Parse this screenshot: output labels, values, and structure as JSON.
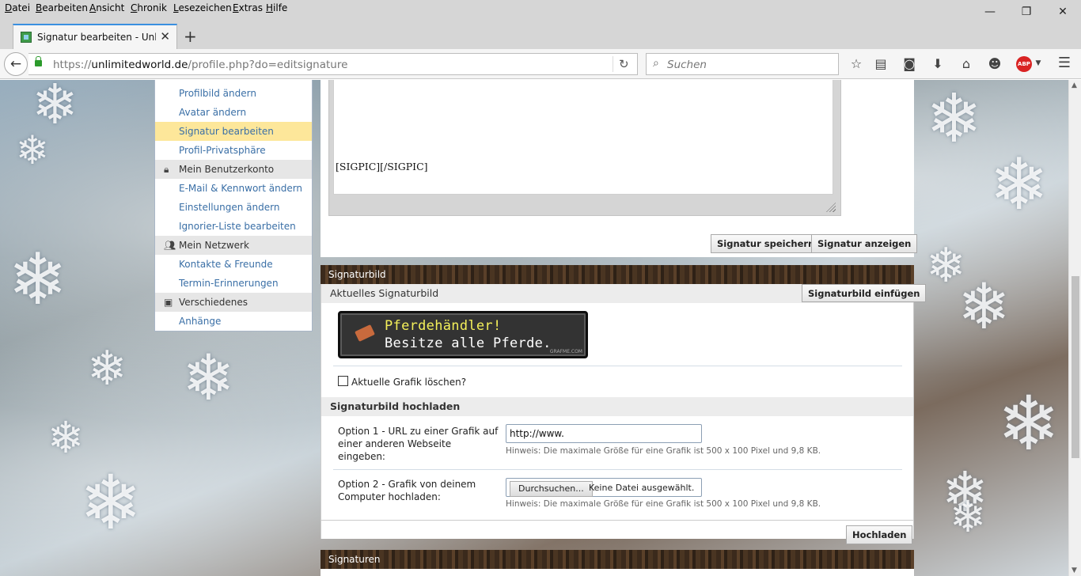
{
  "menubar": {
    "items": [
      {
        "pre": "",
        "key": "D",
        "post": "atei"
      },
      {
        "pre": "",
        "key": "B",
        "post": "earbeiten"
      },
      {
        "pre": "",
        "key": "A",
        "post": "nsicht"
      },
      {
        "pre": "",
        "key": "C",
        "post": "hronik"
      },
      {
        "pre": "",
        "key": "L",
        "post": "esezeichen"
      },
      {
        "pre": "",
        "key": "E",
        "post": "xtras"
      },
      {
        "pre": "",
        "key": "H",
        "post": "ilfe"
      }
    ]
  },
  "window_controls": {
    "minimize": "—",
    "restore": "❐",
    "close": "✕"
  },
  "tab": {
    "title": "Signatur bearbeiten - Unli...",
    "close": "✕",
    "new_tab": "+"
  },
  "navbar": {
    "url_prefix": "https://",
    "url_domain": "unlimitedworld.de",
    "url_path": "/profile.php?do=editsignature",
    "search_placeholder": "Suchen",
    "abp_label": "ABP"
  },
  "sidemenu": {
    "items": [
      {
        "type": "link",
        "label": "Profilbild ändern"
      },
      {
        "type": "link",
        "label": "Avatar ändern"
      },
      {
        "type": "link",
        "label": "Signatur bearbeiten",
        "active": true
      },
      {
        "type": "link",
        "label": "Profil-Privatsphäre"
      },
      {
        "type": "cat",
        "label": "Mein Benutzerkonto",
        "icon": "lock-icon"
      },
      {
        "type": "link",
        "label": "E-Mail & Kennwort ändern"
      },
      {
        "type": "link",
        "label": "Einstellungen ändern"
      },
      {
        "type": "link",
        "label": "Ignorier-Liste bearbeiten"
      },
      {
        "type": "cat",
        "label": "Mein Netzwerk",
        "icon": "people-icon"
      },
      {
        "type": "link",
        "label": "Kontakte & Freunde"
      },
      {
        "type": "link",
        "label": "Termin-Erinnerungen"
      },
      {
        "type": "cat",
        "label": "Verschiedenes",
        "icon": "misc-icon"
      },
      {
        "type": "link",
        "label": "Anhänge"
      }
    ]
  },
  "editor": {
    "content": "[SIGPIC][/SIGPIC]",
    "save_button": "Signatur speichern",
    "preview_button": "Signatur anzeigen"
  },
  "sigbild": {
    "bar_title": "Signaturbild",
    "current_label": "Aktuelles Signaturbild",
    "insert_button": "Signaturbild einfügen",
    "image_line1": "Pferdehändler!",
    "image_line2": "Besitze alle Pferde.",
    "image_watermark": "GRAFME.COM",
    "delete_label": "Aktuelle Grafik löschen?",
    "upload_header": "Signaturbild hochladen",
    "option1_label": "Option 1 - URL zu einer Grafik auf einer anderen Webseite eingeben:",
    "option1_value": "http://www.",
    "hint": "Hinweis: Die maximale Größe für eine Grafik ist 500 x 100 Pixel und 9,8 KB.",
    "option2_label": "Option 2 - Grafik von deinem Computer hochladen:",
    "browse_button": "Durchsuchen...",
    "no_file": "Keine Datei ausgewählt.",
    "upload_button": "Hochladen"
  },
  "signaturen": {
    "bar_title": "Signaturen"
  }
}
